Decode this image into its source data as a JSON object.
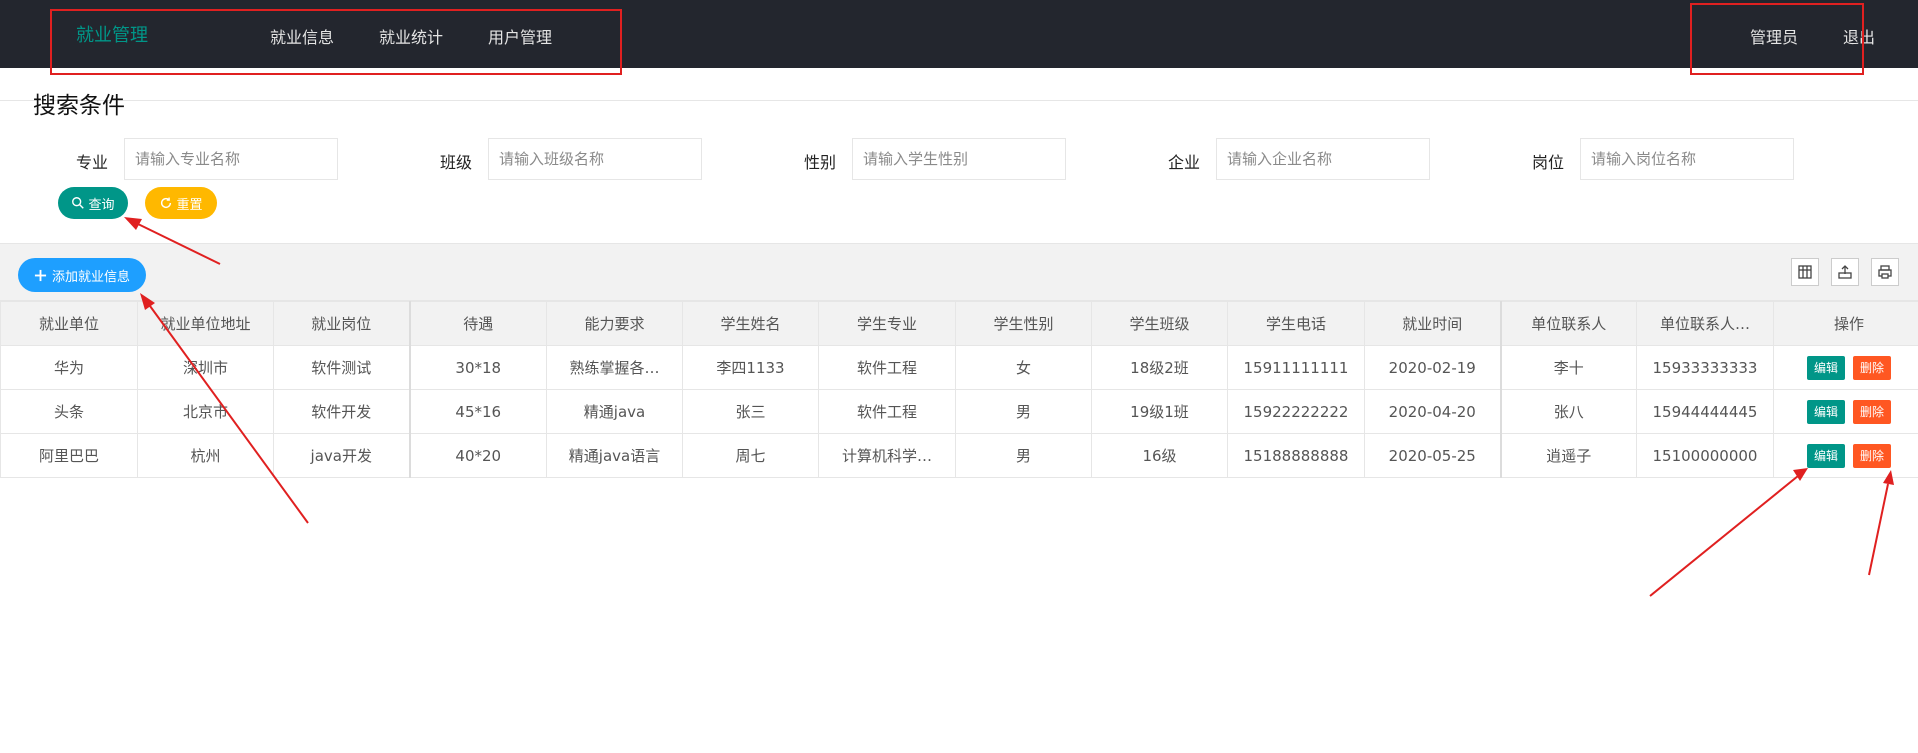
{
  "header": {
    "brand": "就业管理",
    "nav": [
      "就业信息",
      "就业统计",
      "用户管理"
    ],
    "user": "管理员",
    "logout": "退出"
  },
  "search": {
    "title": "搜索条件",
    "fields": [
      {
        "label": "专业",
        "value": "",
        "placeholder": "请输入专业名称"
      },
      {
        "label": "班级",
        "value": "",
        "placeholder": "请输入班级名称"
      },
      {
        "label": "性别",
        "value": "",
        "placeholder": "请输入学生性别"
      },
      {
        "label": "企业",
        "value": "",
        "placeholder": "请输入企业名称"
      },
      {
        "label": "岗位",
        "value": "",
        "placeholder": "请输入岗位名称"
      }
    ],
    "query_label": "查询",
    "reset_label": "重置"
  },
  "toolbar": {
    "add_label": "添加就业信息",
    "icons": [
      "columns-icon",
      "export-icon",
      "print-icon"
    ]
  },
  "table": {
    "columns": [
      "就业单位",
      "就业单位地址",
      "就业岗位",
      "待遇",
      "能力要求",
      "学生姓名",
      "学生专业",
      "学生性别",
      "学生班级",
      "学生电话",
      "就业时间",
      "单位联系人",
      "单位联系人…",
      "操作"
    ],
    "rows": [
      [
        "华为",
        "深圳市",
        "软件测试",
        "30*18",
        "熟练掌握各…",
        "李四1133",
        "软件工程",
        "女",
        "18级2班",
        "15911111111",
        "2020-02-19",
        "李十",
        "15933333333"
      ],
      [
        "头条",
        "北京市",
        "软件开发",
        "45*16",
        "精通java",
        "张三",
        "软件工程",
        "男",
        "19级1班",
        "15922222222",
        "2020-04-20",
        "张八",
        "15944444445"
      ],
      [
        "阿里巴巴",
        "杭州",
        "java开发",
        "40*20",
        "精通java语言",
        "周七",
        "计算机科学…",
        "男",
        "16级",
        "15188888888",
        "2020-05-25",
        "逍遥子",
        "15100000000"
      ]
    ],
    "edit_label": "编辑",
    "delete_label": "删除"
  },
  "colors": {
    "header_bg": "#23262e",
    "brand": "#009688",
    "primary_green": "#009688",
    "warm_yellow": "#ffb800",
    "normal_blue": "#1e9fff",
    "danger_orange": "#ff5722",
    "annotation_red": "#e02020"
  }
}
